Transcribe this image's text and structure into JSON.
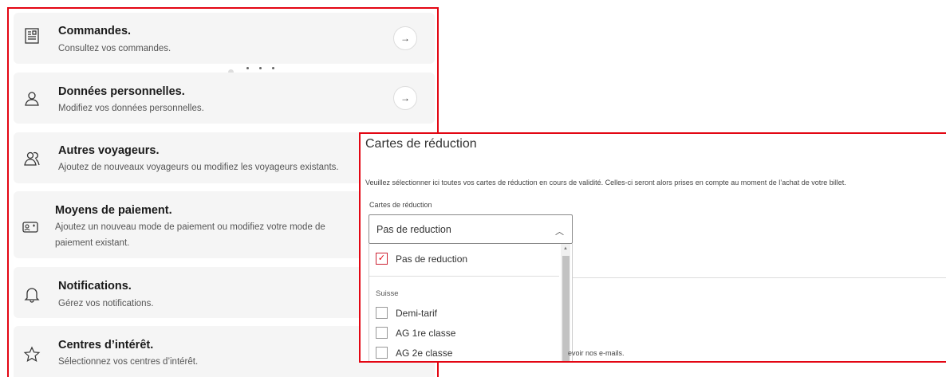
{
  "account_menu": {
    "items": [
      {
        "title": "Commandes.",
        "description": "Consultez vos commandes.",
        "icon": "orders-icon",
        "has_arrow": true
      },
      {
        "title": "Données personnelles.",
        "description": "Modifiez vos données personnelles.",
        "icon": "person-icon",
        "has_arrow": true
      },
      {
        "title": "Autres voyageurs.",
        "description": "Ajoutez de nouveaux voyageurs ou modifiez les voyageurs existants.",
        "icon": "persons-icon",
        "has_arrow": false
      },
      {
        "title": "Moyens de paiement.",
        "description": "Ajoutez un nouveau mode de paiement ou modifiez votre mode de paiement existant.",
        "icon": "payment-card-icon",
        "has_arrow": false
      },
      {
        "title": "Notifications.",
        "description": "Gérez vos notifications.",
        "icon": "bell-icon",
        "has_arrow": false
      },
      {
        "title": "Centres d’intérêt.",
        "description": "Sélectionnez vos centres d’intérêt.",
        "icon": "star-icon",
        "has_arrow": false
      }
    ],
    "arrow_glyph": "→"
  },
  "reduction_cards": {
    "title": "Cartes de réduction",
    "intro": "Veuillez sélectionner ici toutes vos cartes de réduction en cours de validité. Celles-ci seront alors prises en compte au moment de l’achat de votre billet.",
    "field_label": "Cartes de réduction",
    "selected_value": "Pas de reduction",
    "options": [
      {
        "label": "Pas de reduction",
        "checked": true
      },
      {
        "label": "Demi-tarif",
        "checked": false
      },
      {
        "label": "AG 1re classe",
        "checked": false
      },
      {
        "label": "AG 2e classe",
        "checked": false
      }
    ],
    "group_label": "Suisse",
    "behind_text": "evoir nos e-mails."
  },
  "colors": {
    "accent": "#e30613",
    "card_bg": "#f5f5f5"
  }
}
